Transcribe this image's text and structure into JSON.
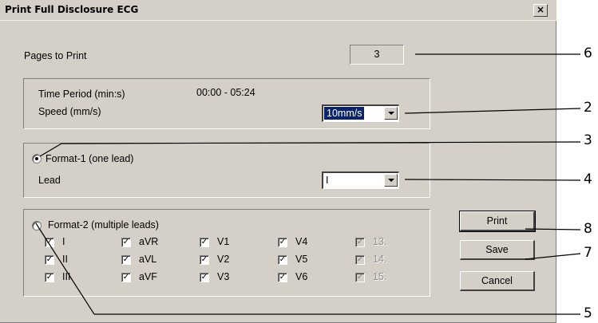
{
  "window": {
    "title": "Print Full Disclosure ECG",
    "close_glyph": "×"
  },
  "pages": {
    "label": "Pages to Print",
    "value": "3"
  },
  "time_speed": {
    "time_label": "Time Period  (min:s)",
    "time_value": "00:00 - 05:24",
    "speed_label": "Speed  (mm/s)",
    "speed_value": "10mm/s"
  },
  "format1": {
    "label": "Format-1   (one lead)",
    "lead_label": "Lead",
    "lead_value": "I",
    "selected": true
  },
  "format2": {
    "label": "Format-2   (multiple leads)",
    "selected": false,
    "leads": [
      [
        "I",
        "aVR",
        "V1",
        "V4",
        "13."
      ],
      [
        "II",
        "aVL",
        "V2",
        "V5",
        "14."
      ],
      [
        "III",
        "aVF",
        "V3",
        "V6",
        "15."
      ]
    ]
  },
  "buttons": {
    "print": "Print",
    "save": "Save",
    "cancel": "Cancel"
  },
  "callouts": [
    "6",
    "2",
    "3",
    "4",
    "8",
    "7",
    "5"
  ]
}
